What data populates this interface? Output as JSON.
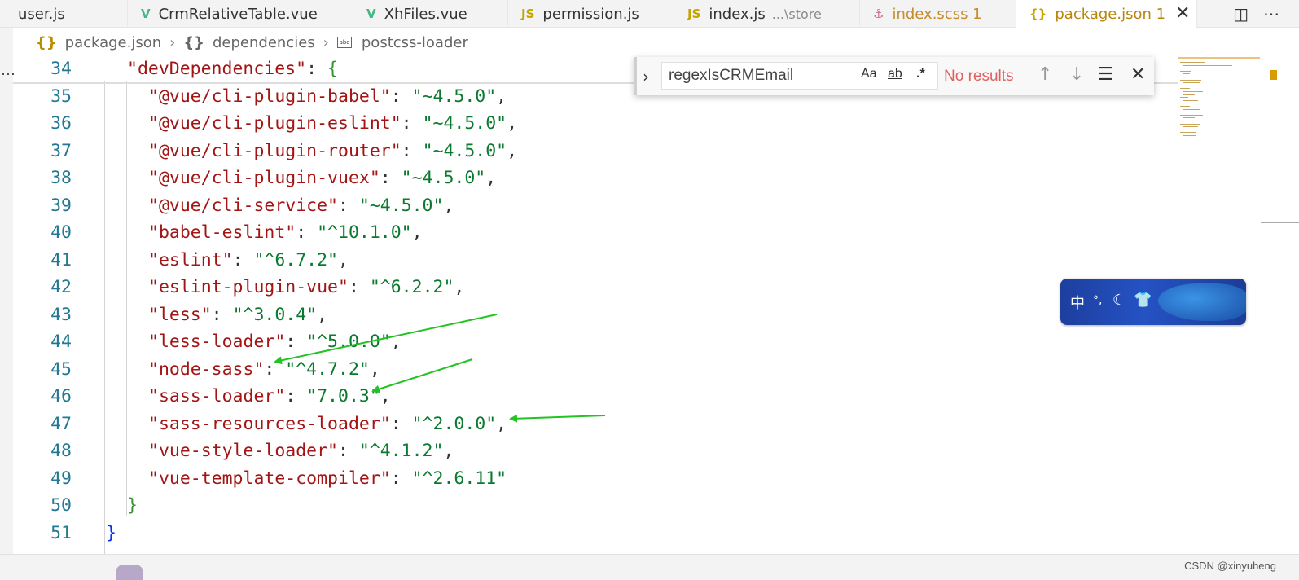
{
  "tabs": [
    {
      "label": "user.js",
      "icon": "js-file-icon",
      "active": false
    },
    {
      "label": "CrmRelativeTable.vue",
      "icon": "vue-file-icon",
      "active": false
    },
    {
      "label": "XhFiles.vue",
      "icon": "vue-file-icon",
      "active": false
    },
    {
      "label": "permission.js",
      "icon": "js-file-icon",
      "active": false
    },
    {
      "label": "index.js",
      "description": "...\\store",
      "icon": "js-file-icon",
      "active": false
    },
    {
      "label": "index.scss 1",
      "icon": "scss-file-icon",
      "active": false
    },
    {
      "label": "package.json 1",
      "icon": "json-file-icon",
      "active": true
    }
  ],
  "tab_icons": {
    "js": "JS",
    "vue": "V",
    "json": "{}",
    "scss": "⚓"
  },
  "breadcrumb": [
    "package.json",
    "dependencies",
    "postcss-loader"
  ],
  "find": {
    "query": "regexIsCRMEmail",
    "status": "No results",
    "options": {
      "match_case": "Aa",
      "whole_word": "ab",
      "regex": ".*"
    }
  },
  "lines": [
    {
      "num": "34",
      "indent": 4,
      "key": "\"devDependencies\"",
      "sep": ": ",
      "brace": "{"
    },
    {
      "num": "35",
      "indent": 6,
      "key": "\"@vue/cli-plugin-babel\"",
      "sep": ": ",
      "value": "\"~4.5.0\"",
      "trail": ","
    },
    {
      "num": "36",
      "indent": 6,
      "key": "\"@vue/cli-plugin-eslint\"",
      "sep": ": ",
      "value": "\"~4.5.0\"",
      "trail": ","
    },
    {
      "num": "37",
      "indent": 6,
      "key": "\"@vue/cli-plugin-router\"",
      "sep": ": ",
      "value": "\"~4.5.0\"",
      "trail": ","
    },
    {
      "num": "38",
      "indent": 6,
      "key": "\"@vue/cli-plugin-vuex\"",
      "sep": ": ",
      "value": "\"~4.5.0\"",
      "trail": ","
    },
    {
      "num": "39",
      "indent": 6,
      "key": "\"@vue/cli-service\"",
      "sep": ": ",
      "value": "\"~4.5.0\"",
      "trail": ","
    },
    {
      "num": "40",
      "indent": 6,
      "key": "\"babel-eslint\"",
      "sep": ": ",
      "value": "\"^10.1.0\"",
      "trail": ","
    },
    {
      "num": "41",
      "indent": 6,
      "key": "\"eslint\"",
      "sep": ": ",
      "value": "\"^6.7.2\"",
      "trail": ","
    },
    {
      "num": "42",
      "indent": 6,
      "key": "\"eslint-plugin-vue\"",
      "sep": ": ",
      "value": "\"^6.2.2\"",
      "trail": ","
    },
    {
      "num": "43",
      "indent": 6,
      "key": "\"less\"",
      "sep": ": ",
      "value": "\"^3.0.4\"",
      "trail": ","
    },
    {
      "num": "44",
      "indent": 6,
      "key": "\"less-loader\"",
      "sep": ": ",
      "value": "\"^5.0.0\"",
      "trail": ","
    },
    {
      "num": "45",
      "indent": 6,
      "key": "\"node-sass\"",
      "sep": ": ",
      "value": "\"^4.7.2\"",
      "trail": ","
    },
    {
      "num": "46",
      "indent": 6,
      "key": "\"sass-loader\"",
      "sep": ": ",
      "value": "\"7.0.3\"",
      "trail": ","
    },
    {
      "num": "47",
      "indent": 6,
      "key": "\"sass-resources-loader\"",
      "sep": ": ",
      "value": "\"^2.0.0\"",
      "trail": ","
    },
    {
      "num": "48",
      "indent": 6,
      "key": "\"vue-style-loader\"",
      "sep": ": ",
      "value": "\"^4.1.2\"",
      "trail": ","
    },
    {
      "num": "49",
      "indent": 6,
      "key": "\"vue-template-compiler\"",
      "sep": ": ",
      "value": "\"^2.6.11\"",
      "trail": ""
    },
    {
      "num": "50",
      "indent": 4,
      "close": "}"
    },
    {
      "num": "51",
      "indent": 2,
      "close": "}"
    }
  ],
  "ime": {
    "mode": "中",
    "punct": "°,",
    "icons": [
      "moon-icon",
      "shirt-icon"
    ]
  },
  "watermark": "CSDN @xinyuheng",
  "colors": {
    "key": "#a31515",
    "value": "#0b7a2f",
    "line_number": "#237893",
    "arrow": "#22c322",
    "no_results": "#e06060",
    "brace_outer": "#0431fa",
    "brace_inner": "#319331"
  }
}
